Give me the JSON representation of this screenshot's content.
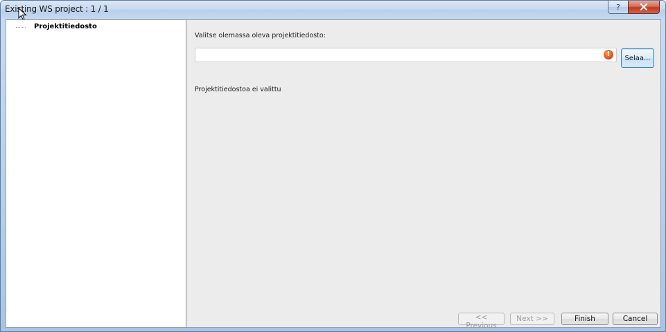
{
  "window": {
    "title": "Existing WS project : 1 / 1",
    "help_label": "?",
    "close_label": "✕"
  },
  "tree": {
    "items": [
      {
        "label": "Projektitiedosto"
      }
    ]
  },
  "form": {
    "prompt": "Valitse olemassa oleva projektitiedosto:",
    "file_path_value": "",
    "error_icon_glyph": "!",
    "browse_label": "Selaa...",
    "status": "Projektitiedostoa ei valittu"
  },
  "buttons": {
    "previous": "<< Previous",
    "next": "Next >>",
    "finish": "Finish",
    "cancel": "Cancel"
  },
  "colors": {
    "close_button": "#c0391f",
    "error_icon": "#e4591b",
    "browse_button_border": "#3c7fb1"
  }
}
